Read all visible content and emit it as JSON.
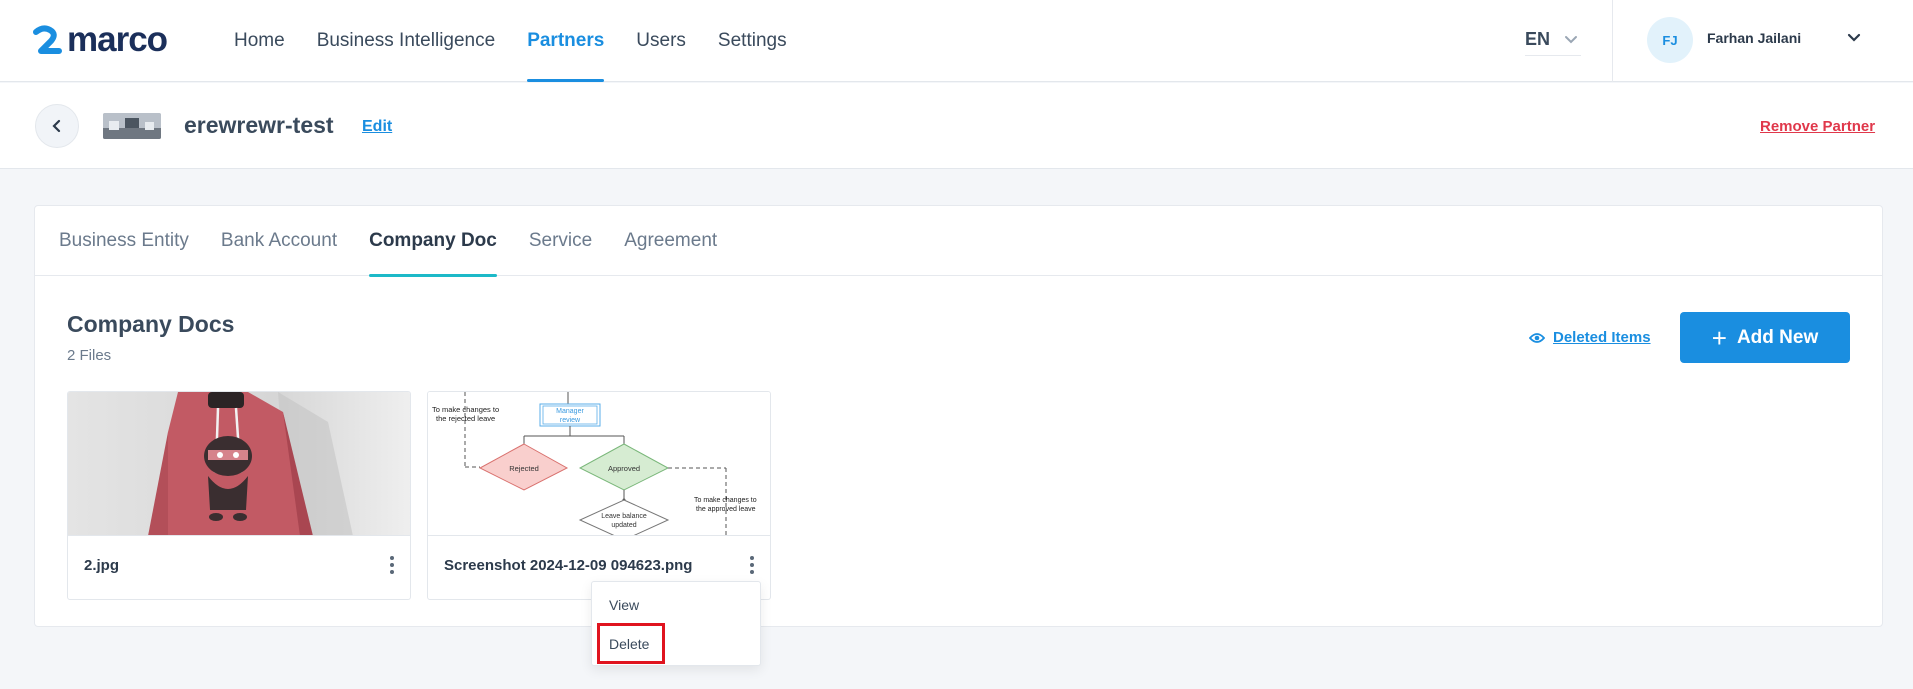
{
  "app": {
    "logo_text": "marco",
    "brand_color": "#1a8ee0"
  },
  "nav": {
    "items": [
      {
        "label": "Home",
        "active": false
      },
      {
        "label": "Business Intelligence",
        "active": false
      },
      {
        "label": "Partners",
        "active": true
      },
      {
        "label": "Users",
        "active": false
      },
      {
        "label": "Settings",
        "active": false
      }
    ],
    "language": "EN",
    "user": {
      "initials": "FJ",
      "name": "Farhan Jailani"
    }
  },
  "partner": {
    "name": "erewrewr-test",
    "edit_label": "Edit",
    "remove_label": "Remove Partner"
  },
  "tabs": [
    {
      "label": "Business Entity",
      "active": false
    },
    {
      "label": "Bank Account",
      "active": false
    },
    {
      "label": "Company Doc",
      "active": true
    },
    {
      "label": "Service",
      "active": false
    },
    {
      "label": "Agreement",
      "active": false
    }
  ],
  "docs": {
    "title": "Company Docs",
    "count_label": "2 Files",
    "deleted_items_label": "Deleted Items",
    "add_new_label": "Add New",
    "files": [
      {
        "name": "2.jpg"
      },
      {
        "name": "Screenshot 2024-12-09 094623.png"
      }
    ]
  },
  "flowchart": {
    "manager_review": "Manager review",
    "rejected": "Rejected",
    "approved": "Approved",
    "leave_balance": "Leave balance updated",
    "note_rejected": "To make changes to the rejected leave",
    "note_approved": "To make changes to the approved leave"
  },
  "context_menu": {
    "view_label": "View",
    "delete_label": "Delete"
  },
  "colors": {
    "accent": "#1a8ee0",
    "tab_underline": "#1cb9c8",
    "danger": "#e0384b",
    "highlight": "#e0141f"
  }
}
